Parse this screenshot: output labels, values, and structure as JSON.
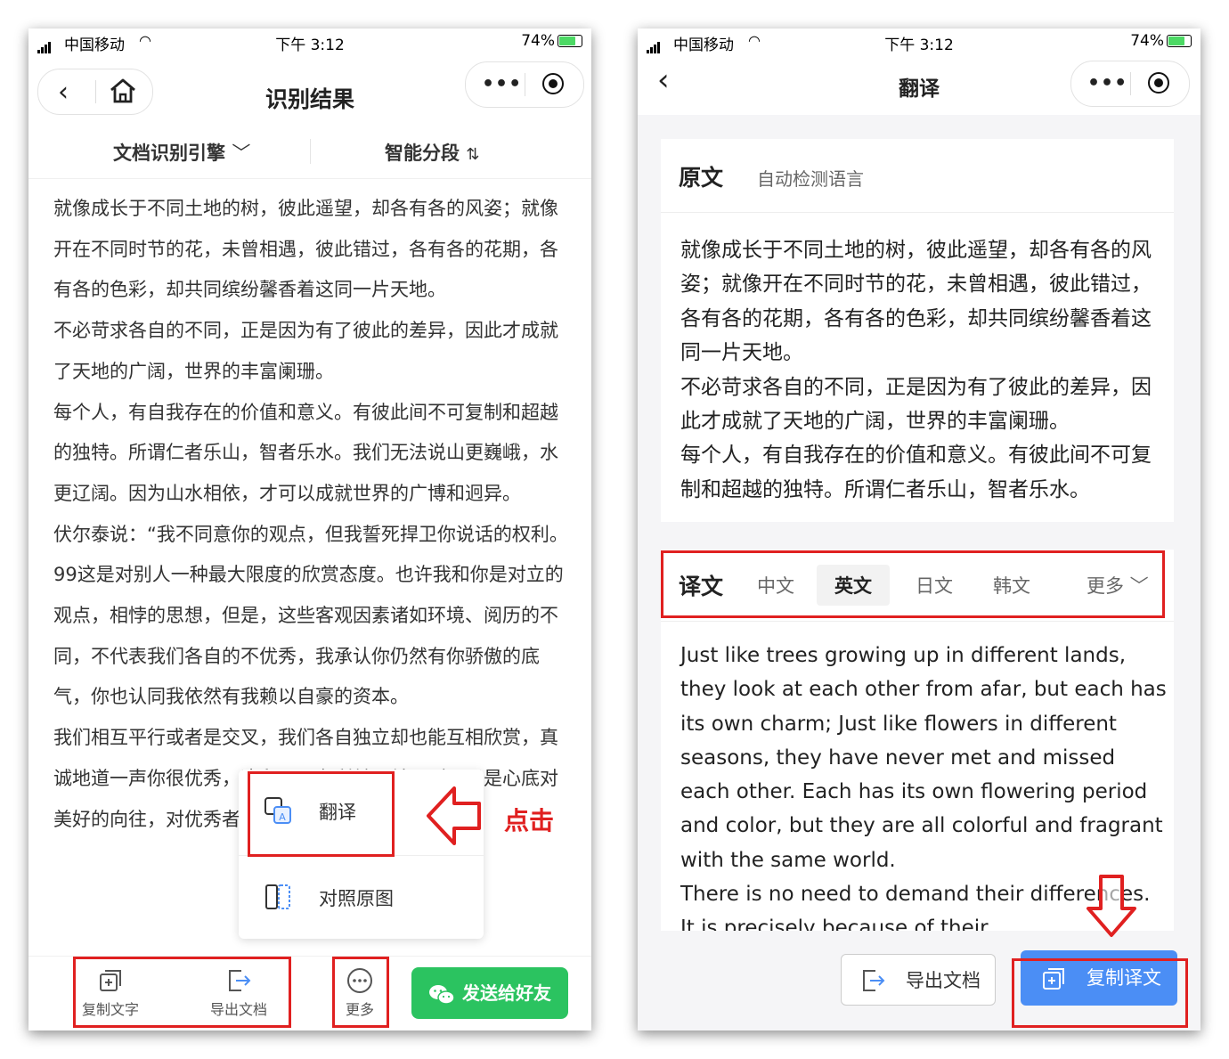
{
  "colors": {
    "accent_red": "#e02020",
    "wechat_green": "#2bc360",
    "primary_blue": "#4b8ef5"
  },
  "status_bar": {
    "carrier": "中国移动",
    "time": "下午 3:12",
    "battery": "74%"
  },
  "left": {
    "title": "识别结果",
    "subtabs": {
      "engine": "文档识别引擎",
      "segment": "智能分段"
    },
    "paragraphs": [
      "就像成长于不同土地的树，彼此遥望，却各有各的风姿；就像开在不同时节的花，未曾相遇，彼此错过，各有各的花期，各有各的色彩，却共同缤纷馨香着这同一片天地。",
      "不必苛求各自的不同，正是因为有了彼此的差异，因此才成就了天地的广阔，世界的丰富阑珊。",
      "每个人，有自我存在的价值和意义。有彼此间不可复制和超越的独特。所谓仁者乐山，智者乐水。我们无法说山更巍峨，水更辽阔。因为山水相依，才可以成就世界的广博和迥异。",
      "伏尔泰说：“我不同意你的观点，但我誓死捍卫你说话的权利。99这是对别人一种最大限度的欣赏态度。也许我和你是对立的观点，相悖的思想，但是，这些客观因素诸如环境、阅历的不同，不代表我们各自的不优秀，我承认你仍然有你骄傲的底气，你也认同我依然有我赖以自豪的资本。",
      "我们相互平行或者是交叉，我们各自独立却也能互相欣赏，真诚地道一声你很优秀，这和是否有利益无关原则，只是心底对美好的向往，对优秀者的钦佩。"
    ],
    "popup": {
      "translate": "翻译",
      "compare": "对照原图"
    },
    "hint": "点击",
    "toolbar": {
      "copy_text": "复制文字",
      "export_doc": "导出文档",
      "more": "更多",
      "send_friend": "发送给好友"
    }
  },
  "right": {
    "title": "翻译",
    "source": {
      "label": "原文",
      "detect": "自动检测语言",
      "paragraphs": [
        "就像成长于不同土地的树，彼此遥望，却各有各的风姿；就像开在不同时节的花，未曾相遇，彼此错过，各有各的花期，各有各的色彩，却共同缤纷馨香着这同一片天地。",
        "不必苛求各自的不同，正是因为有了彼此的差异，因此才成就了天地的广阔，世界的丰富阑珊。",
        "每个人，有自我存在的价值和意义。有彼此间不可复制和超越的独特。所谓仁者乐山，智者乐水。"
      ]
    },
    "target": {
      "label": "译文",
      "langs": [
        "中文",
        "英文",
        "日文",
        "韩文"
      ],
      "selected": "英文",
      "more": "更多",
      "paragraphs": [
        "Just like trees growing up in different lands, they look at each other from afar, but each has its own charm; Just like flowers in different seasons, they have never met and missed each other. Each has its own flowering period and color, but they are all colorful and fragrant with the same world.",
        "There is no need to demand their differences. It is precisely because of their"
      ]
    },
    "buttons": {
      "export": "导出文档",
      "copy_translation": "复制译文"
    }
  }
}
